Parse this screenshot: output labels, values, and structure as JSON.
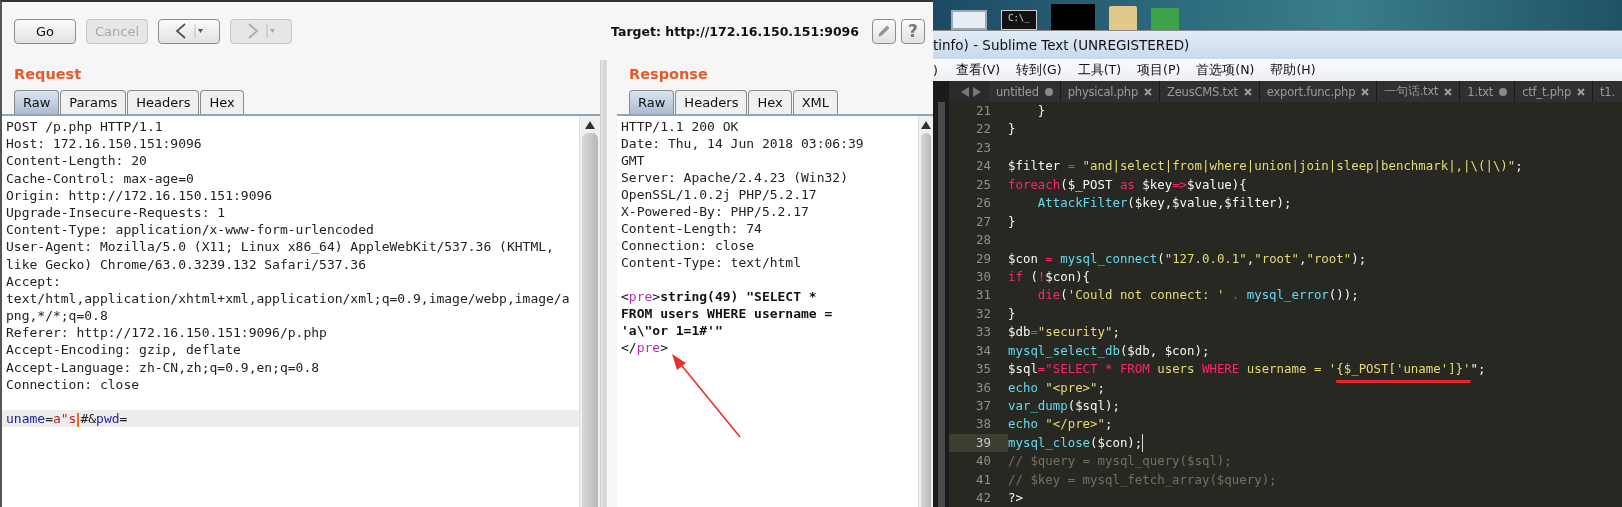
{
  "burp": {
    "toolbar": {
      "buttons": [
        {
          "kind": "text",
          "label": "Go",
          "disabled": false
        },
        {
          "kind": "text",
          "label": "Cancel",
          "disabled": true
        },
        {
          "kind": "back",
          "disabled": false
        },
        {
          "kind": "forward",
          "disabled": true
        }
      ],
      "target": "Target: http://172.16.150.151:9096",
      "help_label": "?"
    },
    "request": {
      "title": "Request",
      "tabs": [
        {
          "label": "Raw",
          "selected": true
        },
        {
          "label": "Params",
          "selected": false
        },
        {
          "label": "Headers",
          "selected": false
        },
        {
          "label": "Hex",
          "selected": false
        }
      ],
      "lines": [
        "POST /p.php HTTP/1.1",
        "Host: 172.16.150.151:9096",
        "Content-Length: 20",
        "Cache-Control: max-age=0",
        "Origin: http://172.16.150.151:9096",
        "Upgrade-Insecure-Requests: 1",
        "Content-Type: application/x-www-form-urlencoded",
        "User-Agent: Mozilla/5.0 (X11; Linux x86_64) AppleWebKit/537.36 (KHTML,",
        "like Gecko) Chrome/63.0.3239.132 Safari/537.36",
        "Accept:",
        "text/html,application/xhtml+xml,application/xml;q=0.9,image/webp,image/a",
        "png,*/*;q=0.8",
        "Referer: http://172.16.150.151:9096/p.php",
        "Accept-Encoding: gzip, deflate",
        "Accept-Language: zh-CN,zh;q=0.9,en;q=0.8",
        "Connection: close"
      ],
      "body": [
        {
          "kind": "name",
          "text": "uname"
        },
        {
          "kind": "plain",
          "text": "="
        },
        {
          "kind": "value",
          "text": "a\"s"
        },
        {
          "kind": "caret"
        },
        {
          "kind": "plain",
          "text": "#&"
        },
        {
          "kind": "name",
          "text": "pwd"
        },
        {
          "kind": "plain",
          "text": "="
        }
      ]
    },
    "response": {
      "title": "Response",
      "tabs": [
        {
          "label": "Raw",
          "selected": true
        },
        {
          "label": "Headers",
          "selected": false
        },
        {
          "label": "Hex",
          "selected": false
        },
        {
          "label": "XML",
          "selected": false
        }
      ],
      "lines": [
        "HTTP/1.1 200 OK",
        "Date: Thu, 14 Jun 2018 03:06:39",
        "GMT",
        "Server: Apache/2.4.23 (Win32)",
        "OpenSSL/1.0.2j PHP/5.2.17",
        "X-Powered-By: PHP/5.2.17",
        "Content-Length: 74",
        "Connection: close",
        "Content-Type: text/html"
      ],
      "body": [
        [
          {
            "kind": "tag",
            "text": "<"
          },
          {
            "kind": "tagname",
            "text": "pre"
          },
          {
            "kind": "tag",
            "text": ">"
          },
          {
            "kind": "text",
            "text": "string(49) \"SELECT *"
          }
        ],
        [
          {
            "kind": "text",
            "text": "FROM users WHERE username ="
          }
        ],
        [
          {
            "kind": "text",
            "text": "'a\\\"or 1=1#'\""
          }
        ],
        [
          {
            "kind": "tag",
            "text": "</"
          },
          {
            "kind": "tagname",
            "text": "pre"
          },
          {
            "kind": "tag",
            "text": ">"
          }
        ]
      ]
    }
  },
  "sublime": {
    "desktop": {
      "cmd_label": "C:\\_"
    },
    "title": "tinfo) - Sublime Text (UNREGISTERED)",
    "menu": [
      ")",
      "查看(V)",
      "转到(G)",
      "工具(T)",
      "项目(P)",
      "首选项(N)",
      "帮助(H)"
    ],
    "tabs": [
      {
        "label": "untitled",
        "dirty": true
      },
      {
        "label": "physical.php",
        "dirty": false
      },
      {
        "label": "ZeusCMS.txt",
        "dirty": false
      },
      {
        "label": "export.func.php",
        "dirty": false
      },
      {
        "label": "一句话.txt",
        "dirty": false
      },
      {
        "label": "1.txt",
        "dirty": true
      },
      {
        "label": "ctf_t.php",
        "dirty": false
      },
      {
        "label": "t1."
      }
    ],
    "lines": [
      {
        "number": "21",
        "current": false,
        "tokens": [
          {
            "kind": "plain",
            "text": "    }"
          }
        ]
      },
      {
        "number": "22",
        "current": false,
        "tokens": [
          {
            "kind": "plain",
            "text": "}"
          }
        ]
      },
      {
        "number": "23",
        "current": false
      },
      {
        "number": "24",
        "current": false,
        "tokens": [
          {
            "kind": "plain",
            "text": "$filter "
          },
          {
            "kind": "kw",
            "text": "="
          },
          {
            "kind": "str",
            "text": " \"and|select|from|where|union|join|sleep|benchmark|,|\\(|\\)\""
          },
          {
            "kind": "plain",
            "text": ";"
          }
        ]
      },
      {
        "number": "25",
        "current": false,
        "tokens": [
          {
            "kind": "kw",
            "text": "foreach"
          },
          {
            "kind": "plain",
            "text": "($_POST "
          },
          {
            "kind": "kw",
            "text": "as"
          },
          {
            "kind": "plain",
            "text": " $key"
          },
          {
            "kind": "kw",
            "text": "=>"
          },
          {
            "kind": "plain",
            "text": "$value){"
          }
        ]
      },
      {
        "number": "26",
        "current": false,
        "tokens": [
          {
            "kind": "fn",
            "text": "    AttackFilter"
          },
          {
            "kind": "plain",
            "text": "($key,$value,$filter);"
          }
        ]
      },
      {
        "number": "27",
        "current": false,
        "tokens": [
          {
            "kind": "plain",
            "text": "}"
          }
        ]
      },
      {
        "number": "28",
        "current": false
      },
      {
        "number": "29",
        "current": false,
        "tokens": [
          {
            "kind": "plain",
            "text": "$con "
          },
          {
            "kind": "kw",
            "text": "="
          },
          {
            "kind": "fn",
            "text": " mysql_connect"
          },
          {
            "kind": "plain",
            "text": "("
          },
          {
            "kind": "str",
            "text": "\"127.0.0.1\""
          },
          {
            "kind": "plain",
            "text": ","
          },
          {
            "kind": "str",
            "text": "\"root\""
          },
          {
            "kind": "plain",
            "text": ","
          },
          {
            "kind": "str",
            "text": "\"root\""
          },
          {
            "kind": "plain",
            "text": ");"
          }
        ]
      },
      {
        "number": "30",
        "current": false,
        "tokens": [
          {
            "kind": "kw",
            "text": "if"
          },
          {
            "kind": "plain",
            "text": " ("
          },
          {
            "kind": "kw",
            "text": "!"
          },
          {
            "kind": "plain",
            "text": "$con){"
          }
        ]
      },
      {
        "number": "31",
        "current": false,
        "tokens": [
          {
            "kind": "kw",
            "text": "    die"
          },
          {
            "kind": "plain",
            "text": "("
          },
          {
            "kind": "str",
            "text": "'Could not connect: ' "
          },
          {
            "kind": "kw",
            "text": "."
          },
          {
            "kind": "fn",
            "text": " mysql_error"
          },
          {
            "kind": "plain",
            "text": "());"
          }
        ]
      },
      {
        "number": "32",
        "current": false,
        "tokens": [
          {
            "kind": "plain",
            "text": "}"
          }
        ]
      },
      {
        "number": "33",
        "current": false,
        "tokens": [
          {
            "kind": "plain",
            "text": "$db"
          },
          {
            "kind": "kw",
            "text": "="
          },
          {
            "kind": "str",
            "text": "\"security\""
          },
          {
            "kind": "plain",
            "text": ";"
          }
        ]
      },
      {
        "number": "34",
        "current": false,
        "tokens": [
          {
            "kind": "fn",
            "text": "mysql_select_db"
          },
          {
            "kind": "plain",
            "text": "($db, $con);"
          }
        ]
      },
      {
        "number": "35",
        "current": false,
        "tokens": [
          {
            "kind": "plain",
            "text": "$sql"
          },
          {
            "kind": "kw",
            "text": "="
          },
          {
            "kind": "kw",
            "text": "\"SELECT * FROM"
          },
          {
            "kind": "str",
            "text": " users "
          },
          {
            "kind": "kw",
            "text": "WHERE"
          },
          {
            "kind": "str",
            "text": " username = '"
          },
          {
            "kind": "str",
            "text": "{$_POST['uname']}'",
            "marked": true
          },
          {
            "kind": "plain",
            "text": "\";"
          }
        ]
      },
      {
        "number": "36",
        "current": false,
        "tokens": [
          {
            "kind": "fn",
            "text": "echo "
          },
          {
            "kind": "str",
            "text": "\"<pre>\""
          },
          {
            "kind": "plain",
            "text": ";"
          }
        ]
      },
      {
        "number": "37",
        "current": false,
        "tokens": [
          {
            "kind": "fn",
            "text": "var_dump"
          },
          {
            "kind": "plain",
            "text": "($sql);"
          }
        ]
      },
      {
        "number": "38",
        "current": false,
        "tokens": [
          {
            "kind": "fn",
            "text": "echo "
          },
          {
            "kind": "str",
            "text": "\"</pre>\""
          },
          {
            "kind": "plain",
            "text": ";"
          }
        ]
      },
      {
        "number": "39",
        "current": true,
        "tokens": [
          {
            "kind": "fn",
            "text": "mysql_close"
          },
          {
            "kind": "plain",
            "text": "($con);"
          }
        ]
      },
      {
        "number": "40",
        "current": false,
        "tokens": [
          {
            "kind": "cm",
            "text": "// $query = mysql_query($sql);"
          }
        ]
      },
      {
        "number": "41",
        "current": false,
        "tokens": [
          {
            "kind": "cm",
            "text": "// $key = mysql_fetch_array($query);"
          }
        ]
      },
      {
        "number": "42",
        "current": false,
        "tokens": [
          {
            "kind": "plain",
            "text": "?>"
          }
        ]
      }
    ]
  }
}
